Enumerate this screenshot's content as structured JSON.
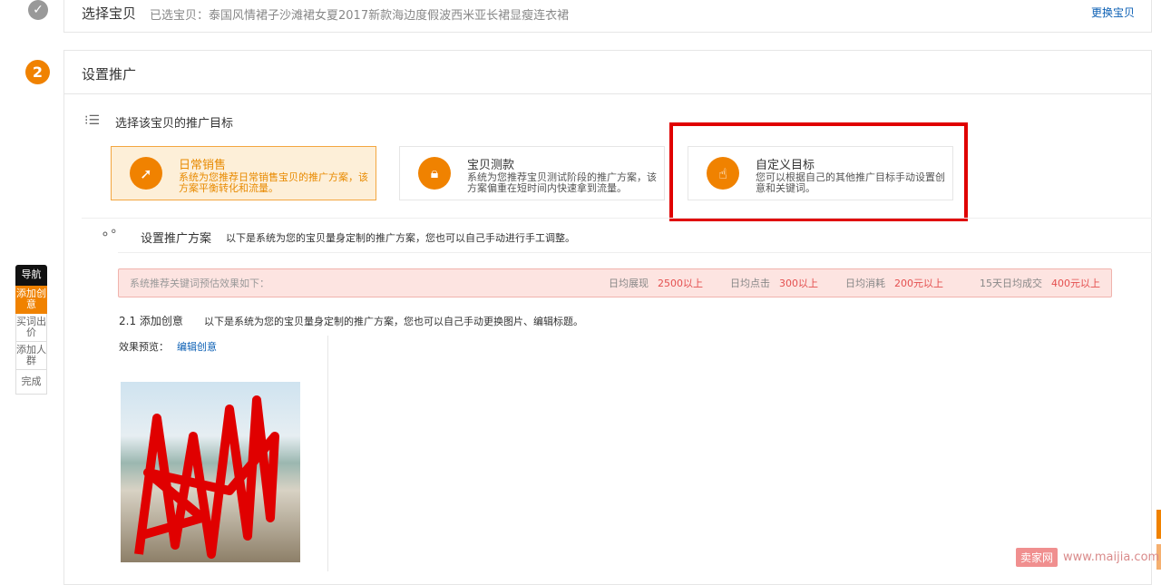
{
  "step1": {
    "title": "选择宝贝",
    "selected": "已选宝贝：泰国风情裙子沙滩裙女夏2017新款海边度假波西米亚长裙显瘦连衣裙",
    "change_link": "更换宝贝",
    "icon": "check-circle-icon"
  },
  "step2": {
    "number": "2",
    "title": "设置推广",
    "goal_section": {
      "title": "选择该宝贝的推广目标",
      "icon": "list-icon",
      "cards": [
        {
          "title": "日常销售",
          "desc": "系统为您推荐日常销售宝贝的推广方案，该方案平衡转化和流量。",
          "icon": "cursor-icon",
          "selected": true
        },
        {
          "title": "宝贝测款",
          "desc": "系统为您推荐宝贝测试阶段的推广方案，该方案偏重在短时间内快速拿到流量。",
          "icon": "lock-icon",
          "selected": false
        },
        {
          "title": "自定义目标",
          "desc": "您可以根据自己的其他推广目标手动设置创意和关键词。",
          "icon": "hand-icon",
          "selected": false
        }
      ]
    },
    "plan_section": {
      "title": "设置推广方案",
      "desc": "以下是系统为您的宝贝量身定制的推广方案，您也可以自己手动进行手工调整。",
      "icon": "nodes-icon"
    },
    "estimate": {
      "label": "系统推荐关键词预估效果如下：",
      "items": [
        {
          "label": "日均展现",
          "value": "2500以上"
        },
        {
          "label": "日均点击",
          "value": "300以上"
        },
        {
          "label": "日均消耗",
          "value": "200元以上"
        },
        {
          "label": "15天日均成交",
          "value": "400元以上"
        }
      ]
    },
    "creative": {
      "title": "2.1 添加创意",
      "desc": "以下是系统为您的宝贝量身定制的推广方案，您也可以自己手动更换图片、编辑标题。",
      "preview_label": "效果预览：",
      "edit_link": "编辑创意"
    }
  },
  "nav": {
    "title": "导航",
    "items": [
      "添加创意",
      "买词出价",
      "添加人群",
      "完成"
    ],
    "active": 0
  },
  "watermark": {
    "brand": "卖家网",
    "url": "www.maijia.com"
  },
  "colors": {
    "accent": "#f08200",
    "highlight": "#e00000",
    "link": "#0b5fb4"
  }
}
